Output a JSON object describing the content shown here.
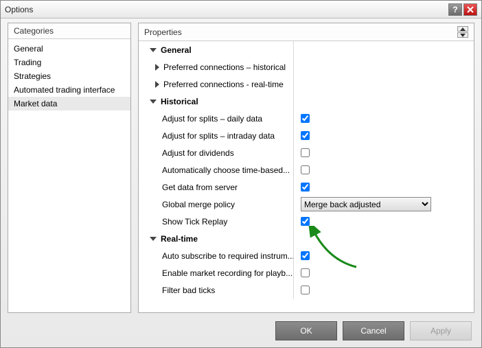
{
  "window": {
    "title": "Options"
  },
  "categories": {
    "header": "Categories",
    "items": [
      "General",
      "Trading",
      "Strategies",
      "Automated trading interface",
      "Market data"
    ],
    "selected": 4
  },
  "properties": {
    "header": "Properties",
    "groups": [
      {
        "label": "General",
        "expanded": true,
        "children": [
          {
            "label": "Preferred connections – historical",
            "control": "expander",
            "expanded": false
          },
          {
            "label": "Preferred connections - real-time",
            "control": "expander",
            "expanded": false
          }
        ]
      },
      {
        "label": "Historical",
        "expanded": true,
        "children": [
          {
            "label": "Adjust for splits – daily data",
            "control": "checkbox",
            "value": true
          },
          {
            "label": "Adjust for splits – intraday data",
            "control": "checkbox",
            "value": true
          },
          {
            "label": "Adjust for dividends",
            "control": "checkbox",
            "value": false
          },
          {
            "label": "Automatically choose time-based...",
            "control": "checkbox",
            "value": false
          },
          {
            "label": "Get data from server",
            "control": "checkbox",
            "value": true
          },
          {
            "label": "Global merge policy",
            "control": "select",
            "value": "Merge back adjusted",
            "options": [
              "Merge back adjusted"
            ]
          },
          {
            "label": "Show Tick Replay",
            "control": "checkbox",
            "value": true,
            "highlight": true
          }
        ]
      },
      {
        "label": "Real-time",
        "expanded": true,
        "children": [
          {
            "label": "Auto subscribe to required instrum...",
            "control": "checkbox",
            "value": true
          },
          {
            "label": "Enable market recording for playb...",
            "control": "checkbox",
            "value": false
          },
          {
            "label": "Filter bad ticks",
            "control": "checkbox",
            "value": false
          }
        ]
      }
    ]
  },
  "buttons": {
    "ok": "OK",
    "cancel": "Cancel",
    "apply": "Apply"
  }
}
